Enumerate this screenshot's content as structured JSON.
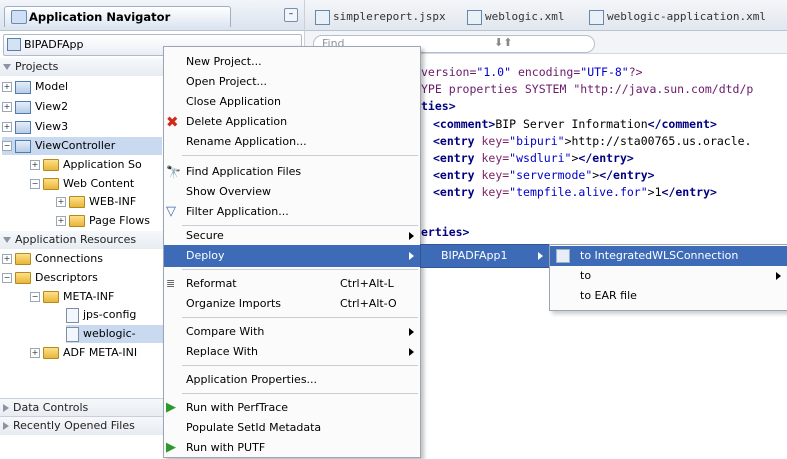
{
  "navigator": {
    "title": "Application Navigator",
    "app_selector": "BIPADFApp",
    "sections": {
      "projects": "Projects",
      "resources": "Application Resources",
      "data_controls": "Data Controls",
      "recent": "Recently Opened Files"
    },
    "tree": {
      "model": "Model",
      "view2": "View2",
      "view3": "View3",
      "viewcontroller": "ViewController",
      "app_sources": "Application So",
      "web_content": "Web Content",
      "web_inf": "WEB-INF",
      "page_flows": "Page Flows",
      "connections": "Connections",
      "descriptors": "Descriptors",
      "meta_inf": "META-INF",
      "jps_config": "jps-config",
      "weblogic": "weblogic-",
      "adf_meta_inf": "ADF META-INI"
    }
  },
  "editor": {
    "tabs": [
      "simplereport.jspx",
      "weblogic.xml",
      "weblogic-application.xml"
    ],
    "find_placeholder": "Find",
    "code": {
      "line1a": "version=",
      "line1b": "\"1.0\"",
      "line1c": " encoding=",
      "line1d": "\"UTF-8\"",
      "line1e": "?>",
      "line2": "YPE properties SYSTEM \"http://java.sun.com/dtd/p",
      "line3": "ties>",
      "comment_open": "<comment>",
      "comment_text": "BIP Server Information",
      "comment_close": "</comment>",
      "entry_open": "<entry",
      "key_attr": " key=",
      "e1_key": "\"bipuri\"",
      "e1_rest": ">http://sta00765.us.oracle.",
      "e2_key": "\"wsdluri\"",
      "e3_key": "\"servermode\"",
      "e4_key": "\"tempfile.alive.for\"",
      "e4_val": "1",
      "gt": ">",
      "entry_close": "</entry>",
      "close_props": "erties>"
    }
  },
  "context_menu": {
    "new_project": "New Project...",
    "open_project": "Open Project...",
    "close_app": "Close Application",
    "delete_app": "Delete Application",
    "rename_app": "Rename Application...",
    "find_files": "Find Application Files",
    "show_overview": "Show Overview",
    "filter_app": "Filter Application...",
    "secure": "Secure",
    "deploy": "Deploy",
    "reformat": "Reformat",
    "reformat_acc": "Ctrl+Alt-L",
    "organize": "Organize Imports",
    "organize_acc": "Ctrl+Alt-O",
    "compare": "Compare With",
    "replace": "Replace With",
    "app_props": "Application Properties...",
    "run_perftrace": "Run with PerfTrace",
    "populate": "Populate SetId Metadata",
    "run_putf": "Run with PUTF"
  },
  "deploy_submenu": {
    "profile": "BIPADFApp1",
    "to_integrated": "to IntegratedWLSConnection",
    "to": "to",
    "to_ear": "to EAR file"
  },
  "colors": {
    "highlight": "#3d6bb7",
    "xml_tag": "#000080",
    "xml_string": "#0000c8"
  }
}
